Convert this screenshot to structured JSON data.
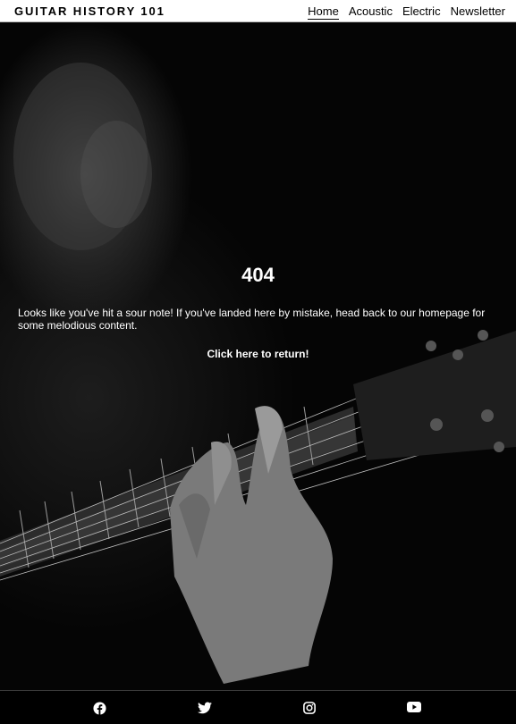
{
  "header": {
    "site_title": "GUITAR HISTORY 101",
    "nav": [
      {
        "label": "Home",
        "active": true
      },
      {
        "label": "Acoustic",
        "active": false
      },
      {
        "label": "Electric",
        "active": false
      },
      {
        "label": "Newsletter",
        "active": false
      }
    ]
  },
  "main": {
    "error_code": "404",
    "message": "Looks like you've hit a sour note! If you've landed here by mistake, head back to our homepage for some melodious content.",
    "return_link": "Click here to return!"
  },
  "footer": {
    "social_icons": [
      "facebook-icon",
      "twitter-icon",
      "instagram-icon",
      "youtube-icon"
    ]
  }
}
